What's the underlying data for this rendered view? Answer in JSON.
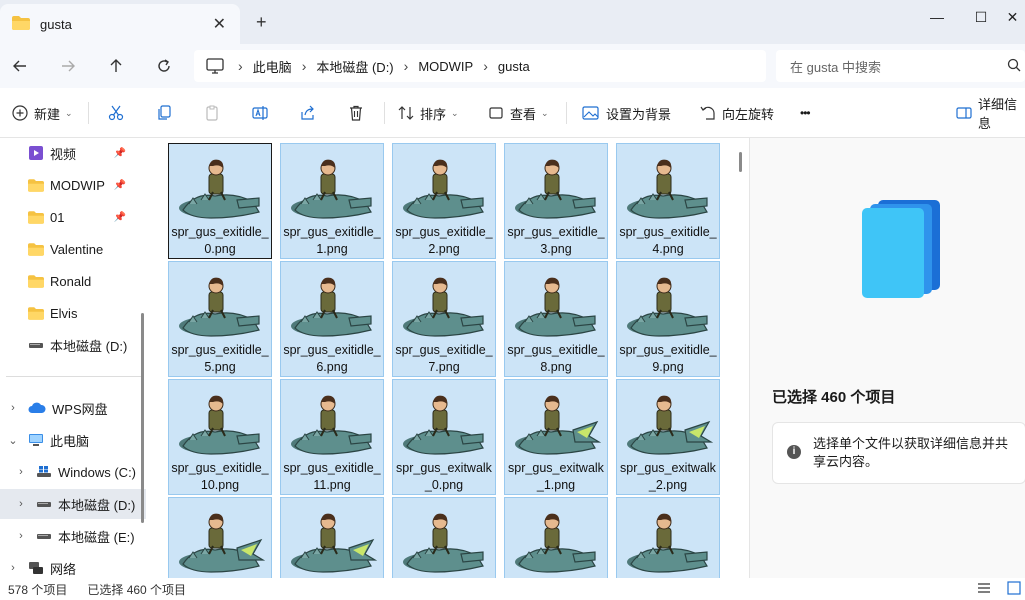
{
  "window": {
    "tab_title": "gusta",
    "new_tab": "+",
    "close": "✕",
    "minimize": "—",
    "maximize": "☐",
    "win_close": "✕"
  },
  "address": {
    "crumbs": [
      "此电脑",
      "本地磁盘 (D:)",
      "MODWIP",
      "gusta"
    ],
    "separator": "›",
    "search_placeholder": "在 gusta 中搜索"
  },
  "toolbar": {
    "new": "新建",
    "sort": "排序",
    "view": "查看",
    "set_background": "设置为背景",
    "rotate_left": "向左旋转",
    "more": "•••",
    "details": "详细信息"
  },
  "nav": {
    "items": [
      {
        "label": "视频",
        "icon": "video-icon",
        "pinned": true
      },
      {
        "label": "MODWIP",
        "icon": "folder-icon",
        "pinned": true
      },
      {
        "label": "01",
        "icon": "folder-icon",
        "pinned": true
      },
      {
        "label": "Valentine",
        "icon": "folder-icon",
        "pinned": false
      },
      {
        "label": "Ronald",
        "icon": "folder-icon",
        "pinned": false
      },
      {
        "label": "Elvis",
        "icon": "folder-icon",
        "pinned": false
      },
      {
        "label": "本地磁盘 (D:)",
        "icon": "drive-icon",
        "pinned": false
      }
    ],
    "tree": [
      {
        "label": "WPS网盘",
        "icon": "cloud-icon",
        "chevron": "›"
      },
      {
        "label": "此电脑",
        "icon": "pc-icon",
        "chevron": "⌄"
      },
      {
        "label": "Windows (C:)",
        "icon": "windows-drive-icon",
        "chevron": "›"
      },
      {
        "label": "本地磁盘 (D:)",
        "icon": "drive-icon",
        "chevron": "›"
      },
      {
        "label": "本地磁盘 (E:)",
        "icon": "drive-icon",
        "chevron": "›"
      },
      {
        "label": "网络",
        "icon": "network-icon",
        "chevron": "›"
      }
    ]
  },
  "files": [
    {
      "name": "spr_gus_exitidle_0.png"
    },
    {
      "name": "spr_gus_exitidle_1.png"
    },
    {
      "name": "spr_gus_exitidle_2.png"
    },
    {
      "name": "spr_gus_exitidle_3.png"
    },
    {
      "name": "spr_gus_exitidle_4.png"
    },
    {
      "name": "spr_gus_exitidle_5.png"
    },
    {
      "name": "spr_gus_exitidle_6.png"
    },
    {
      "name": "spr_gus_exitidle_7.png"
    },
    {
      "name": "spr_gus_exitidle_8.png"
    },
    {
      "name": "spr_gus_exitidle_9.png"
    },
    {
      "name": "spr_gus_exitidle_10.png"
    },
    {
      "name": "spr_gus_exitidle_11.png"
    },
    {
      "name": "spr_gus_exitwalk_0.png"
    },
    {
      "name": "spr_gus_exitwalk_1.png"
    },
    {
      "name": "spr_gus_exitwalk_2.png"
    },
    {
      "name": ""
    },
    {
      "name": ""
    },
    {
      "name": ""
    },
    {
      "name": ""
    },
    {
      "name": ""
    }
  ],
  "details": {
    "selected_title": "已选择 460 个项目",
    "info_text": "选择单个文件以获取详细信息并共享云内容。"
  },
  "status": {
    "item_count": "578 个项目",
    "selected_count": "已选择 460 个项目"
  },
  "colors": {
    "selection_bg": "#cce4f7",
    "selection_border": "#99c9ef",
    "accent": "#0078d4"
  }
}
